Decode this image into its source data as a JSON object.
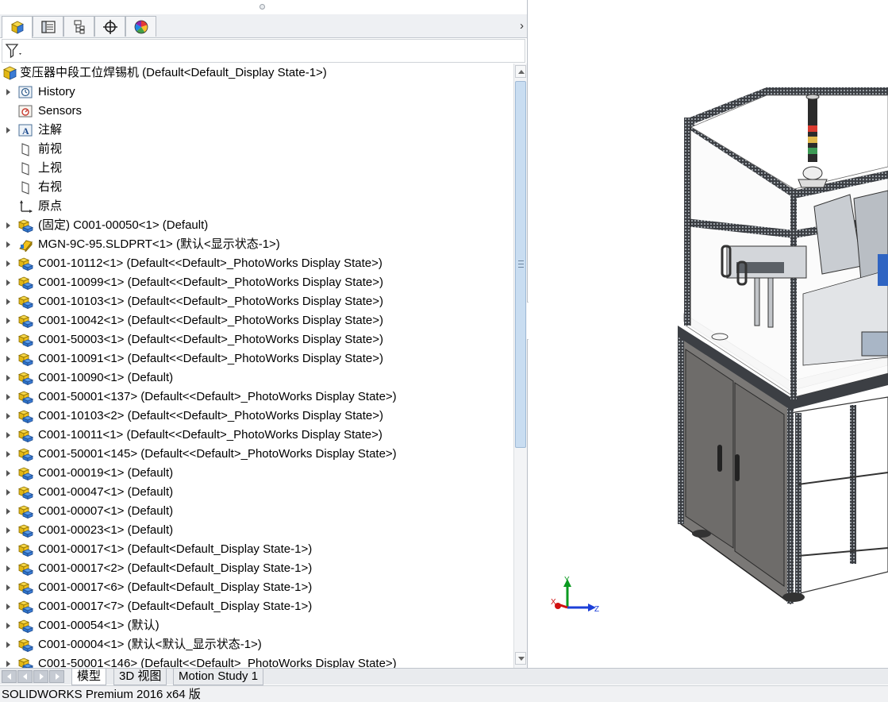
{
  "feature_manager": {
    "tabs": [
      {
        "name": "featuremanager-design-tree-tab",
        "icon": "assembly-cube-icon",
        "active": true
      },
      {
        "name": "property-manager-tab",
        "icon": "property-list-icon",
        "active": false
      },
      {
        "name": "configuration-manager-tab",
        "icon": "configuration-icon",
        "active": false
      },
      {
        "name": "dimxpert-manager-tab",
        "icon": "crosshair-icon",
        "active": false
      },
      {
        "name": "display-manager-tab",
        "icon": "color-wheel-icon",
        "active": false
      }
    ],
    "expand_glyph": "›",
    "filter": {
      "icon": "filter-funnel-icon",
      "value": ""
    }
  },
  "tree": {
    "root": {
      "label": "变压器中段工位焊锡机  (Default<Default_Display State-1>)",
      "icon": "assembly-icon"
    },
    "items": [
      {
        "label": "History",
        "icon": "history-icon",
        "expandable": true
      },
      {
        "label": "Sensors",
        "icon": "sensor-icon",
        "expandable": false
      },
      {
        "label": "注解",
        "icon": "annotation-icon",
        "expandable": true
      },
      {
        "label": "前视",
        "icon": "plane-icon",
        "expandable": false
      },
      {
        "label": "上视",
        "icon": "plane-icon",
        "expandable": false
      },
      {
        "label": "右视",
        "icon": "plane-icon",
        "expandable": false
      },
      {
        "label": "原点",
        "icon": "origin-icon",
        "expandable": false
      },
      {
        "label": "(固定) C001-00050<1> (Default)",
        "icon": "subassembly-icon",
        "expandable": true
      },
      {
        "label": "MGN-9C-95.SLDPRT<1> (默认<显示状态-1>)",
        "icon": "part-icon",
        "expandable": true
      },
      {
        "label": "C001-10112<1> (Default<<Default>_PhotoWorks Display State>)",
        "icon": "subassembly-icon",
        "expandable": true
      },
      {
        "label": "C001-10099<1> (Default<<Default>_PhotoWorks Display State>)",
        "icon": "subassembly-icon",
        "expandable": true
      },
      {
        "label": "C001-10103<1> (Default<<Default>_PhotoWorks Display State>)",
        "icon": "subassembly-icon",
        "expandable": true
      },
      {
        "label": "C001-10042<1> (Default<<Default>_PhotoWorks Display State>)",
        "icon": "subassembly-icon",
        "expandable": true
      },
      {
        "label": "C001-50003<1> (Default<<Default>_PhotoWorks Display State>)",
        "icon": "subassembly-icon",
        "expandable": true
      },
      {
        "label": "C001-10091<1> (Default<<Default>_PhotoWorks Display State>)",
        "icon": "subassembly-icon",
        "expandable": true
      },
      {
        "label": "C001-10090<1> (Default)",
        "icon": "subassembly-icon",
        "expandable": true
      },
      {
        "label": "C001-50001<137> (Default<<Default>_PhotoWorks Display State>)",
        "icon": "subassembly-icon",
        "expandable": true
      },
      {
        "label": "C001-10103<2> (Default<<Default>_PhotoWorks Display State>)",
        "icon": "subassembly-icon",
        "expandable": true
      },
      {
        "label": "C001-10011<1> (Default<<Default>_PhotoWorks Display State>)",
        "icon": "subassembly-icon",
        "expandable": true
      },
      {
        "label": "C001-50001<145> (Default<<Default>_PhotoWorks Display State>)",
        "icon": "subassembly-icon",
        "expandable": true
      },
      {
        "label": "C001-00019<1> (Default)",
        "icon": "subassembly-icon",
        "expandable": true
      },
      {
        "label": "C001-00047<1> (Default)",
        "icon": "subassembly-icon",
        "expandable": true
      },
      {
        "label": "C001-00007<1> (Default)",
        "icon": "subassembly-icon",
        "expandable": true
      },
      {
        "label": "C001-00023<1> (Default)",
        "icon": "subassembly-icon",
        "expandable": true
      },
      {
        "label": "C001-00017<1> (Default<Default_Display State-1>)",
        "icon": "subassembly-icon",
        "expandable": true
      },
      {
        "label": "C001-00017<2> (Default<Default_Display State-1>)",
        "icon": "subassembly-icon",
        "expandable": true
      },
      {
        "label": "C001-00017<6> (Default<Default_Display State-1>)",
        "icon": "subassembly-icon",
        "expandable": true
      },
      {
        "label": "C001-00017<7> (Default<Default_Display State-1>)",
        "icon": "subassembly-icon",
        "expandable": true
      },
      {
        "label": "C001-00054<1> (默认)",
        "icon": "subassembly-icon",
        "expandable": true
      },
      {
        "label": "C001-00004<1> (默认<默认_显示状态-1>)",
        "icon": "subassembly-icon",
        "expandable": true
      },
      {
        "label": "C001-50001<146> (Default<<Default>_PhotoWorks Display State>)",
        "icon": "subassembly-icon",
        "expandable": true
      }
    ]
  },
  "bottom_tabs": [
    {
      "label": "模型",
      "active": true
    },
    {
      "label": "3D 视图",
      "active": false
    },
    {
      "label": "Motion Study 1",
      "active": false
    }
  ],
  "status_bar": {
    "text": "SOLIDWORKS Premium 2016 x64 版"
  },
  "triad": {
    "x": "X",
    "y": "Y",
    "z": "Z"
  },
  "colors": {
    "x_axis": "#d01010",
    "y_axis": "#0b9a20",
    "z_axis": "#1c3fd8",
    "assembly_yellow": "#f2c21a",
    "assembly_blue": "#2c74c9",
    "frame_aluminum": "#e6e8ea",
    "cabinet_panel": "#7c7a78"
  }
}
